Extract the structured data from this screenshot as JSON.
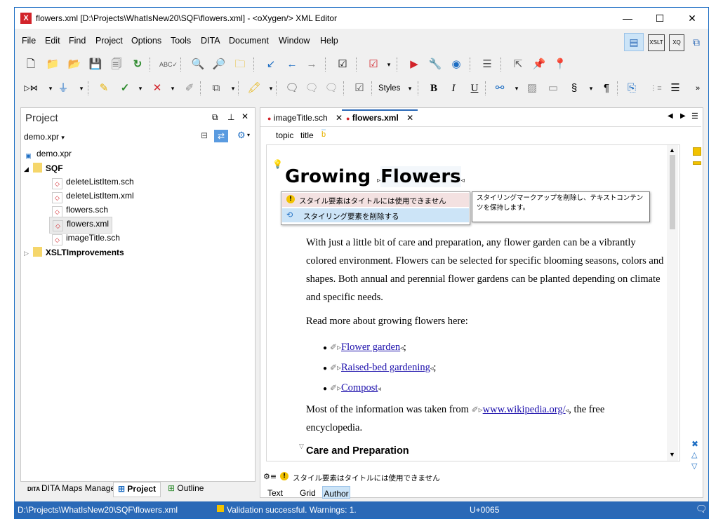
{
  "window": {
    "title": "flowers.xml [D:\\Projects\\WhatIsNew20\\SQF\\flowers.xml] - <oXygen/> XML Editor",
    "app_icon": "X",
    "controls": {
      "minimize": "—",
      "maximize": "☐",
      "close": "✕"
    }
  },
  "menu": [
    "File",
    "Edit",
    "Find",
    "Project",
    "Options",
    "Tools",
    "DITA",
    "Document",
    "Window",
    "Help"
  ],
  "toolbar2": {
    "styles_label": "Styles"
  },
  "project_panel": {
    "title": "Project",
    "project_file": "demo.xpr",
    "tree": {
      "root": "demo.xpr",
      "folder_sqf": "SQF",
      "files": [
        "deleteListItem.sch",
        "deleteListItem.xml",
        "flowers.sch",
        "flowers.xml",
        "imageTitle.sch"
      ],
      "folder_xslt": "XSLTImprovements"
    },
    "bottom_tabs": [
      "DITA Maps Manager",
      "Project",
      "Outline"
    ]
  },
  "editor": {
    "tabs": [
      "imageTitle.sch",
      "flowers.xml"
    ],
    "breadcrumb": [
      "topic",
      "title"
    ],
    "breadcrumb_marker": "b",
    "heading_word1": "Growing",
    "heading_word2": "Flowers",
    "quickfix": {
      "message": "スタイル要素はタイトルには使用できません",
      "fix": "スタイリング要素を削除する",
      "tooltip": "スタイリングマークアップを削除し、テキストコンテンツを保持します。"
    },
    "para1": "With just a little bit of care and preparation, any flower garden can be a vibrantly colored environment. Flowers can be selected for specific blooming seasons, colors and shapes. Both annual and perennial flower gardens can be planted depending on climate and specific needs.",
    "para2": "Read more about growing flowers here:",
    "list": [
      {
        "link": "Flower garden",
        "suffix": ";"
      },
      {
        "link": "Raised-bed gardening",
        "suffix": ";"
      },
      {
        "link": "Compost",
        "suffix": ""
      }
    ],
    "para3_before": "Most of the information was taken from",
    "para3_link": "www.wikipedia.org/",
    "para3_after": ", the free",
    "para3_line2": "encyclopedia.",
    "section_heading": "Care and Preparation",
    "problem_message": "スタイル要素はタイトルには使用できません",
    "mode_tabs": [
      "Text",
      "Grid",
      "Author"
    ]
  },
  "status": {
    "path": "D:\\Projects\\WhatIsNew20\\SQF\\flowers.xml",
    "validation": "Validation successful. Warnings: 1.",
    "unicode": "U+0065"
  },
  "colors": {
    "accent": "#2a69b7",
    "selected_tab_bg": "#cce4f7",
    "warning": "#f2c200",
    "error": "#d2232a"
  }
}
